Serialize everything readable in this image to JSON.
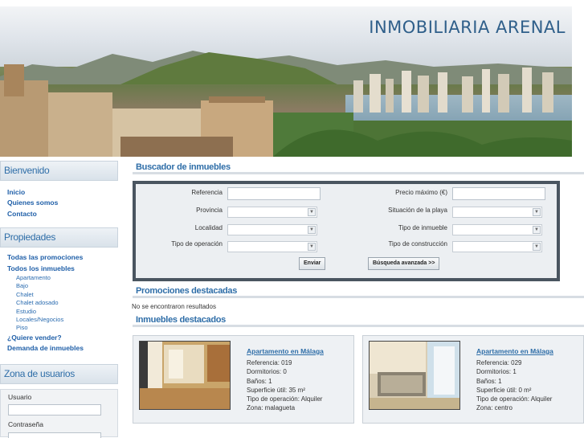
{
  "brand": {
    "name": "INMOBILIARIA ARENAL"
  },
  "sidebar": {
    "welcome": {
      "title": "Bienvenido",
      "links": [
        "Inicio",
        "Quienes somos",
        "Contacto"
      ]
    },
    "properties": {
      "title": "Propiedades",
      "links": {
        "all_promotions": "Todas las promociones",
        "all_properties": "Todos los inmuebles",
        "types": [
          "Apartamento",
          "Bajo",
          "Chalet",
          "Chalet adosado",
          "Estudio",
          "Locales/Negocios",
          "Piso"
        ],
        "sell": "¿Quiere vender?",
        "demand": "Demanda de inmuebles"
      }
    },
    "users": {
      "title": "Zona de usuarios",
      "user_label": "Usuario",
      "user_value": "",
      "password_label": "Contraseña",
      "password_value": ""
    }
  },
  "search": {
    "title": "Buscador de inmuebles",
    "fields": {
      "referencia": "Referencia",
      "provincia": "Provincia",
      "localidad": "Localidad",
      "tipo_operacion": "Tipo de operación",
      "precio_maximo": "Precio máximo (€)",
      "situacion_playa": "Situación de la playa",
      "tipo_inmueble": "Tipo de inmueble",
      "tipo_construccion": "Tipo de construcción"
    },
    "values": {
      "referencia": "",
      "precio_maximo": ""
    },
    "send_button": "Enviar",
    "advanced_button": "Búsqueda avanzada >>"
  },
  "promotions": {
    "title": "Promociones destacadas",
    "empty_text": "No se encontraron resultados"
  },
  "featured": {
    "title": "Inmuebles destacados",
    "items": [
      {
        "title": "Apartamento en Málaga",
        "reference": "Referencia: 019",
        "bedrooms": "Dormitorios: 0",
        "bathrooms": "Baños: 1",
        "surface": "Superficie útil: 35 m²",
        "operation": "Tipo de operación: Alquiler",
        "zone": "Zona: malagueta"
      },
      {
        "title": "Apartamento en Málaga",
        "reference": "Referencia: 029",
        "bedrooms": "Dormitorios: 1",
        "bathrooms": "Baños: 1",
        "surface": "Superficie útil: 0 m²",
        "operation": "Tipo de operación: Alquiler",
        "zone": "Zona: centro"
      }
    ]
  },
  "colors": {
    "accent": "#2f6ea8",
    "brand": "#2f5f8a",
    "search_border": "#4a5560"
  }
}
